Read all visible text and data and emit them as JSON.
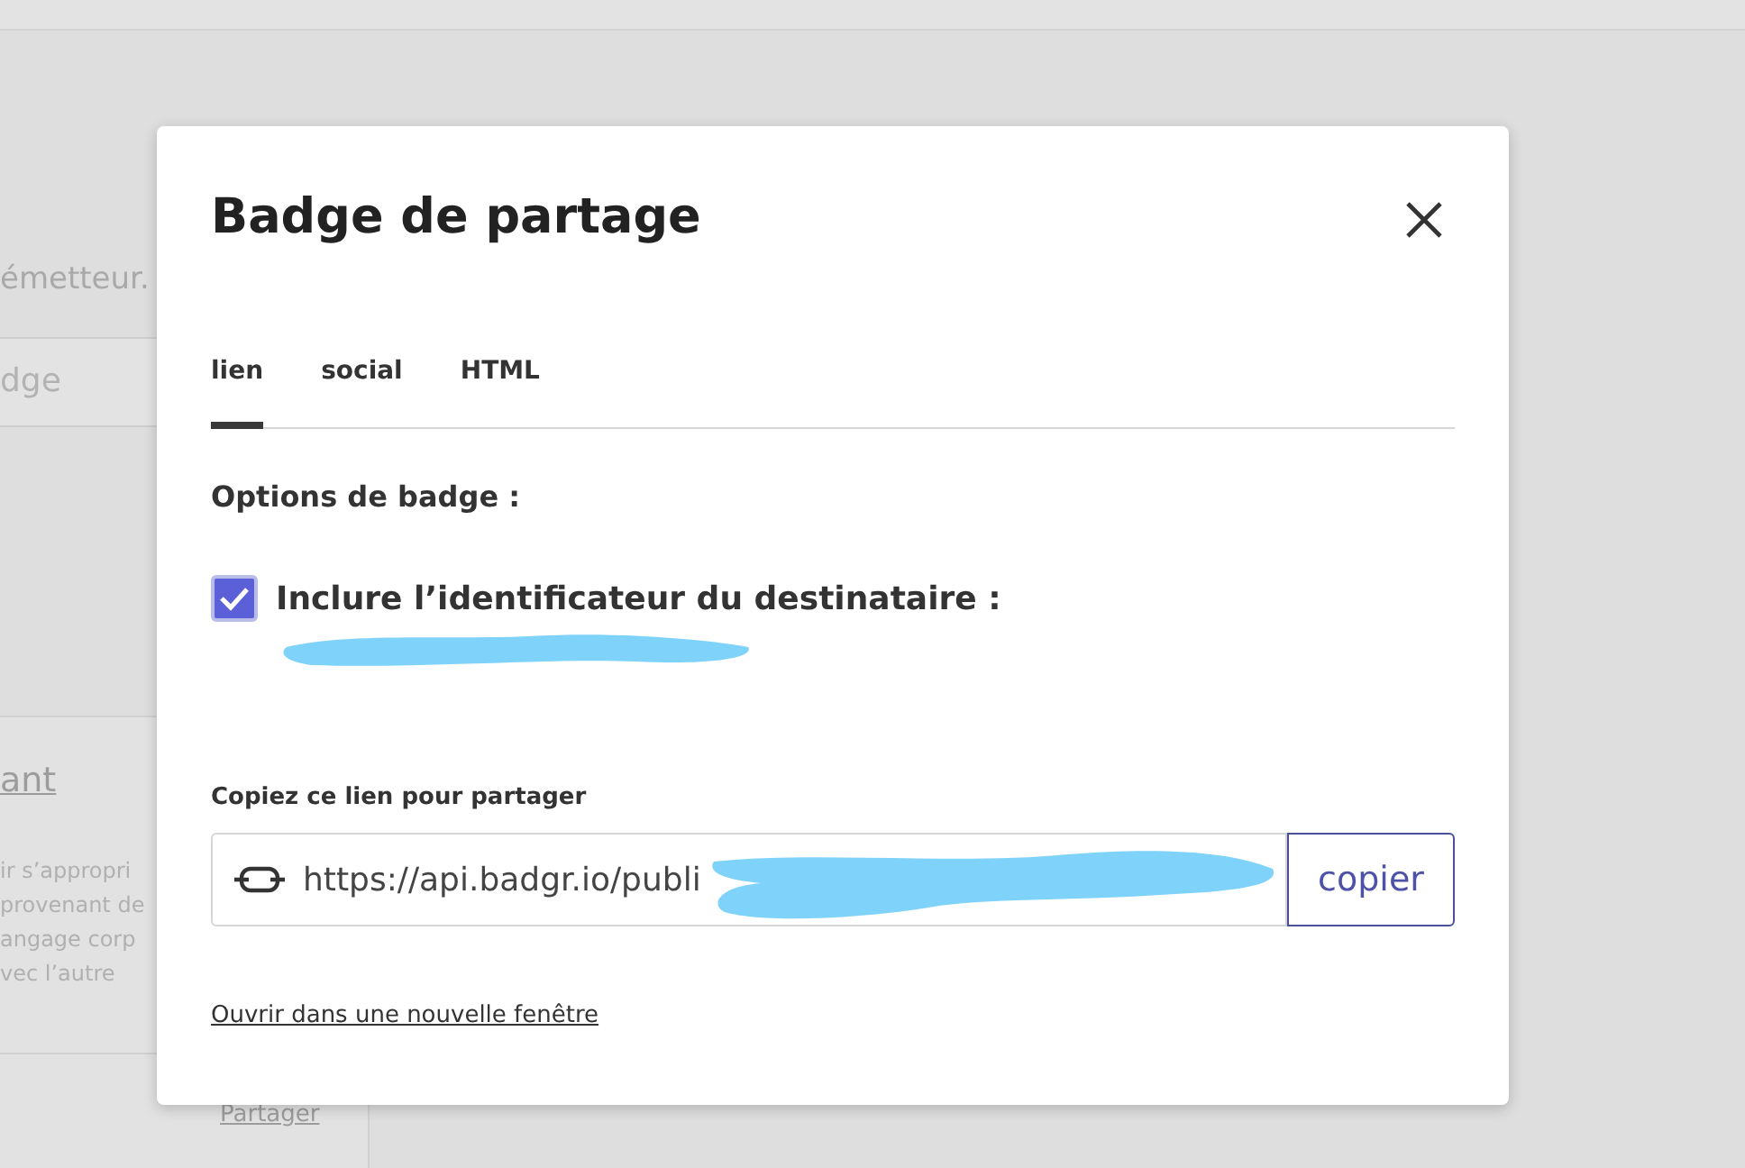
{
  "background": {
    "texts": [
      "émetteur.",
      "dge"
    ],
    "card": {
      "link": "ant",
      "lines": [
        "ir s’appropri",
        "provenant de",
        "angage corp",
        "vec l’autre"
      ],
      "share": "Partager"
    }
  },
  "dialog": {
    "title": "Badge de partage",
    "tabs": [
      {
        "label": "lien",
        "selected": true
      },
      {
        "label": "social",
        "selected": false
      },
      {
        "label": "HTML",
        "selected": false
      }
    ],
    "options_heading": "Options de badge :",
    "include_recipient": {
      "label": "Inclure l’identificateur du destinataire :",
      "checked": true
    },
    "copy_label": "Copiez ce lien pour partager",
    "link_field": {
      "value": "https://api.badgr.io/publi"
    },
    "copy_button": "copier",
    "open_link": "Ouvrir dans une nouvelle fenêtre"
  }
}
